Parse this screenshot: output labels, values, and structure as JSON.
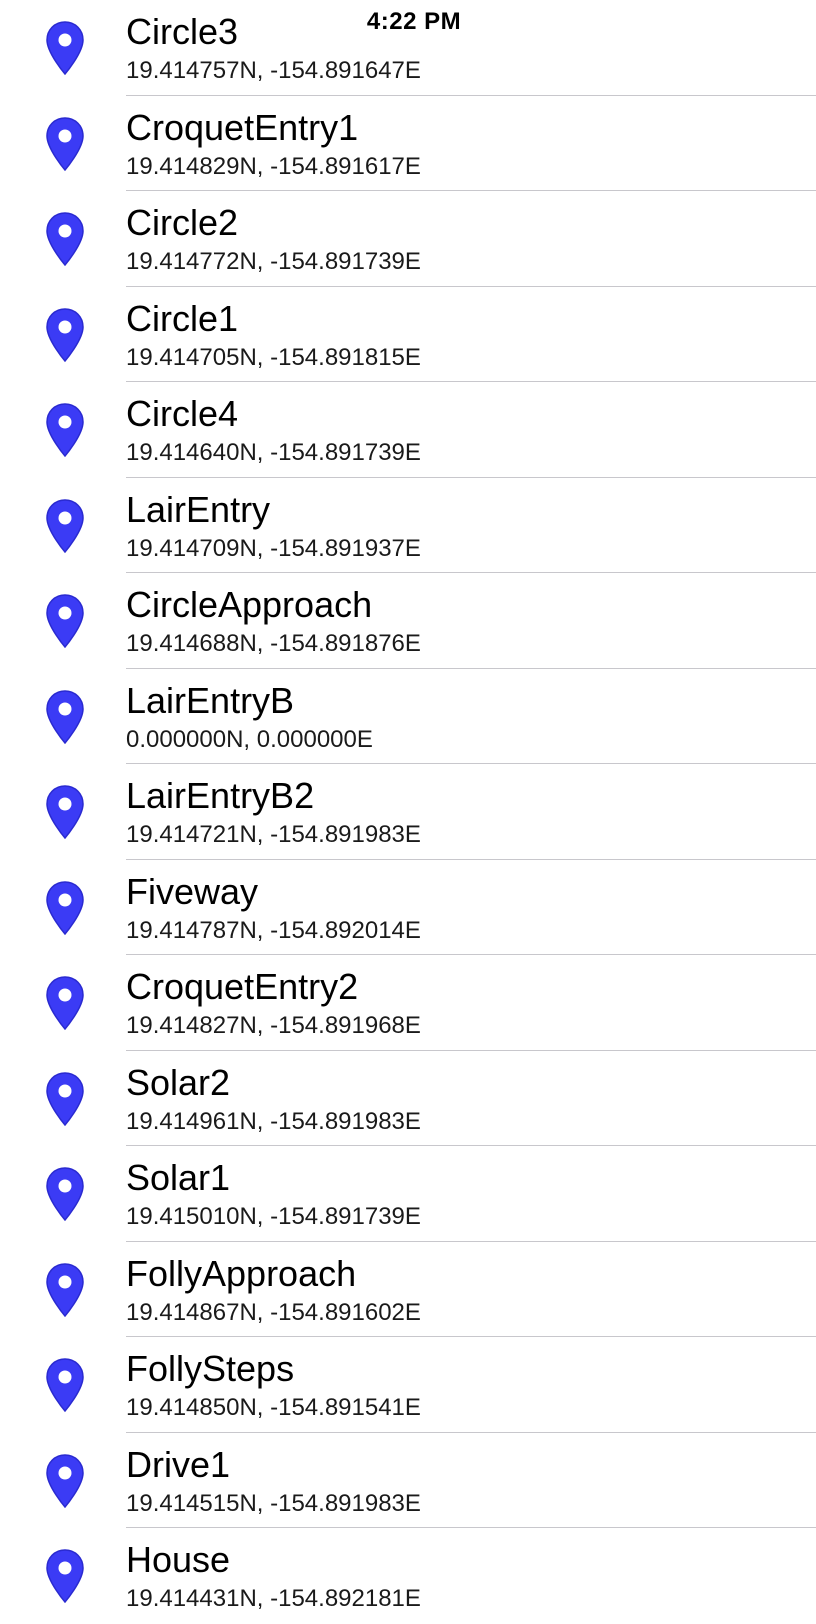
{
  "status_bar": {
    "time": "4:22 PM"
  },
  "colors": {
    "pin": "#3b3bf5",
    "separator": "#c8c7cc"
  },
  "locations": [
    {
      "name": "Circle3",
      "coords": "19.414757N, -154.891647E",
      "icon": "map-pin-icon"
    },
    {
      "name": "CroquetEntry1",
      "coords": "19.414829N, -154.891617E",
      "icon": "map-pin-icon"
    },
    {
      "name": "Circle2",
      "coords": "19.414772N, -154.891739E",
      "icon": "map-pin-icon"
    },
    {
      "name": "Circle1",
      "coords": "19.414705N, -154.891815E",
      "icon": "map-pin-icon"
    },
    {
      "name": "Circle4",
      "coords": "19.414640N, -154.891739E",
      "icon": "map-pin-icon"
    },
    {
      "name": "LairEntry",
      "coords": "19.414709N, -154.891937E",
      "icon": "map-pin-icon"
    },
    {
      "name": "CircleApproach",
      "coords": "19.414688N, -154.891876E",
      "icon": "map-pin-icon"
    },
    {
      "name": "LairEntryB",
      "coords": "0.000000N, 0.000000E",
      "icon": "map-pin-icon"
    },
    {
      "name": "LairEntryB2",
      "coords": "19.414721N, -154.891983E",
      "icon": "map-pin-icon"
    },
    {
      "name": "Fiveway",
      "coords": "19.414787N, -154.892014E",
      "icon": "map-pin-icon"
    },
    {
      "name": "CroquetEntry2",
      "coords": "19.414827N, -154.891968E",
      "icon": "map-pin-icon"
    },
    {
      "name": "Solar2",
      "coords": "19.414961N, -154.891983E",
      "icon": "map-pin-icon"
    },
    {
      "name": "Solar1",
      "coords": "19.415010N, -154.891739E",
      "icon": "map-pin-icon"
    },
    {
      "name": "FollyApproach",
      "coords": "19.414867N, -154.891602E",
      "icon": "map-pin-icon"
    },
    {
      "name": "FollySteps",
      "coords": "19.414850N, -154.891541E",
      "icon": "map-pin-icon"
    },
    {
      "name": "Drive1",
      "coords": "19.414515N, -154.891983E",
      "icon": "map-pin-icon"
    },
    {
      "name": "House",
      "coords": "19.414431N, -154.892181E",
      "icon": "map-pin-icon"
    }
  ]
}
